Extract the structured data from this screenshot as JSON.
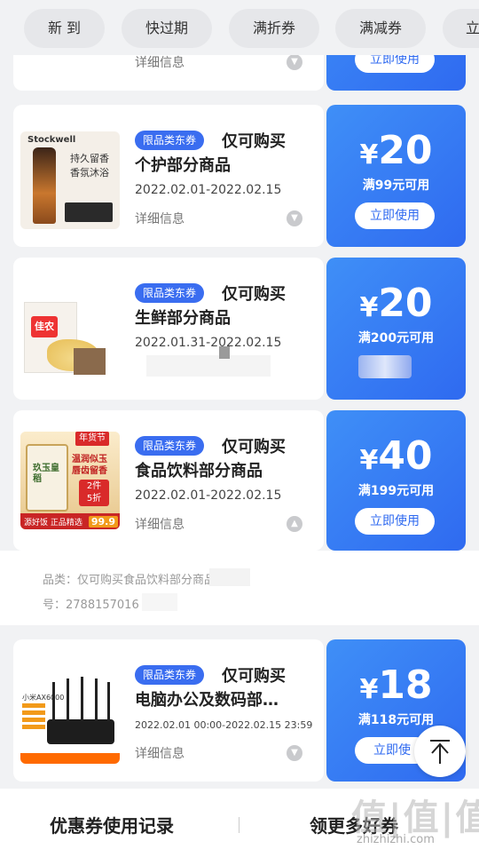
{
  "tabs": [
    "新 到",
    "快过期",
    "满折券",
    "满减券",
    "立"
  ],
  "coupons": [
    {
      "tag": "",
      "title1": "",
      "title2": "",
      "date": "",
      "detail": "详细信息",
      "amount": "",
      "condition": "",
      "button": "立即使用"
    },
    {
      "tag": "限品类东券",
      "title1": "仅可购买",
      "title2": "个护部分商品",
      "date": "2022.02.01-2022.02.15",
      "detail": "详细信息",
      "amount": "20",
      "condition": "满99元可用",
      "button": "立即使用",
      "image": {
        "brand": "Stockwell",
        "text1": "持久留香",
        "text2": "香氛沐浴"
      }
    },
    {
      "tag": "限品类东券",
      "title1": "仅可购买",
      "title2": "生鲜部分商品",
      "date": "2022.01.31-2022.02.15",
      "detail": "",
      "amount": "20",
      "condition": "满200元可用",
      "button": "",
      "image": {
        "brand": "佳农"
      }
    },
    {
      "tag": "限品类东券",
      "title1": "仅可购买",
      "title2": "食品饮料部分商品",
      "date": "2022.02.01-2022.02.15",
      "detail": "详细信息",
      "amount": "40",
      "condition": "满199元可用",
      "button": "立即使用",
      "image": {
        "badge": "年货节",
        "text1": "温润似玉",
        "text2": "唇齿留香",
        "promo1": "2件",
        "promo2": "5折",
        "footer": "源好饭 正品精选",
        "price": "99.9",
        "bag": "玖玉皇稻"
      }
    },
    {
      "tag": "限品类东券",
      "title1": "仅可购买",
      "title2": "电脑办公及数码部…",
      "date": "2022.02.01 00:00-2022.02.15 23:59",
      "detail": "详细信息",
      "amount": "18",
      "condition": "满118元可用",
      "button": "立即使",
      "image": {
        "brand": "mi",
        "model": "小米AX6000"
      }
    }
  ],
  "expanded_info": {
    "category": "品类：仅可购买食品饮料部分商品",
    "number": "号：2788157016"
  },
  "currency": "¥",
  "bottom_bar": {
    "left": "优惠券使用记录",
    "right": "领更多好券"
  },
  "watermark": {
    "big": "值|值|值",
    "small": "zhizhizhi.com"
  },
  "colors": {
    "accent": "#2f6af0",
    "accent_light": "#3f8ff7",
    "background": "#f1f2f4"
  }
}
